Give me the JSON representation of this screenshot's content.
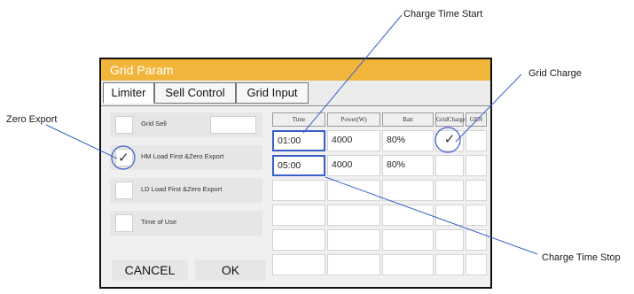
{
  "annotations": {
    "charge_time_start": "Charge Time Start",
    "grid_charge": "Grid Charge",
    "zero_export": "Zero Export",
    "charge_time_stop": "Charge Time Stop"
  },
  "window": {
    "title": "Grid Param"
  },
  "tabs": [
    {
      "label": "Limiter",
      "active": true
    },
    {
      "label": "Sell Control",
      "active": false
    },
    {
      "label": "Grid Input",
      "active": false
    }
  ],
  "options": {
    "grid_sell": {
      "label": "Grid Sell",
      "value": ""
    },
    "hm_load": {
      "label": "HM Load First &Zero Export",
      "checked": true
    },
    "ld_load": {
      "label": "LD Load First &Zero Export",
      "checked": false
    },
    "time_of_use": {
      "label": "Time of Use",
      "checked": false
    }
  },
  "table": {
    "headers": [
      "Time",
      "Power(W)",
      "Batt",
      "GridCharge",
      "GEN"
    ],
    "rows": [
      {
        "time": "01:00",
        "power": "4000",
        "batt": "80%",
        "grid_charge": true,
        "gen": false
      },
      {
        "time": "05:00",
        "power": "4000",
        "batt": "80%",
        "grid_charge": false,
        "gen": false
      },
      {
        "time": "",
        "power": "",
        "batt": "",
        "grid_charge": false,
        "gen": false
      },
      {
        "time": "",
        "power": "",
        "batt": "",
        "grid_charge": false,
        "gen": false
      },
      {
        "time": "",
        "power": "",
        "batt": "",
        "grid_charge": false,
        "gen": false
      },
      {
        "time": "",
        "power": "",
        "batt": "",
        "grid_charge": false,
        "gen": false
      }
    ]
  },
  "buttons": {
    "cancel": "CANCEL",
    "ok": "OK"
  },
  "tick_glyph": "✓",
  "colors": {
    "title_bar": "#f2b53c",
    "callout_line": "#3a5fc9"
  }
}
